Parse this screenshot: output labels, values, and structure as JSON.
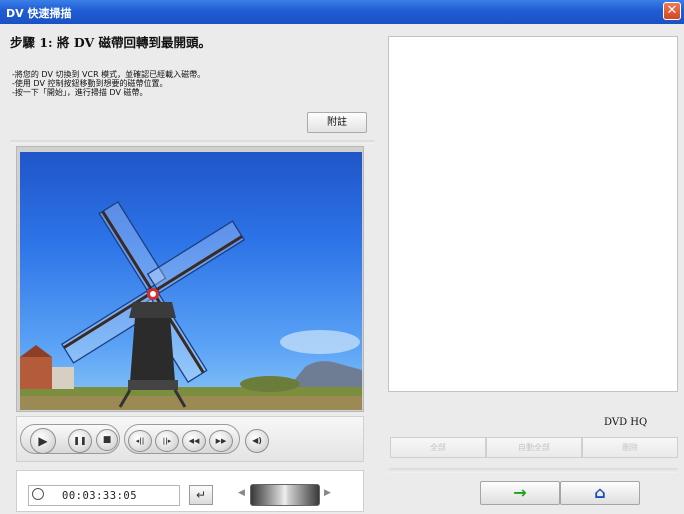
{
  "window": {
    "title": "DV 快速掃描",
    "close_glyph": "✕"
  },
  "step": {
    "heading": "步驟 1: 將 DV 磁帶回轉到最開頭。",
    "instructions": "-將您的 DV 切換到 VCR 模式，並確認已經載入磁帶。\n-使用 DV 控制按鈕移動到想要的磁帶位置。\n-按一下「開始」，進行掃描 DV 磁帶。",
    "notes_label": "附註"
  },
  "player": {
    "timecode": "00:03:33:05",
    "enter_glyph": "↵",
    "buttons": [
      {
        "name": "play-button",
        "glyph": "▶"
      },
      {
        "name": "pause-button",
        "glyph": "❚❚"
      },
      {
        "name": "stop-button",
        "glyph": "■"
      },
      {
        "name": "previous-frame-button",
        "glyph": "◂||"
      },
      {
        "name": "next-frame-button",
        "glyph": "||▸"
      },
      {
        "name": "rewind-button",
        "glyph": "◀◀"
      },
      {
        "name": "fast-forward-button",
        "glyph": "▶▶"
      },
      {
        "name": "volume-button",
        "glyph": "◀)"
      }
    ],
    "shuttle_left_glyph": "◀",
    "shuttle_right_glyph": "▶"
  },
  "right": {
    "quality": "DVD HQ",
    "buttons": [
      "全部",
      "自動全部",
      "刪除"
    ],
    "next_glyph": "→",
    "home_glyph": "⌂"
  },
  "colors": {
    "accent_green": "#1aa31a",
    "home_blue": "#1c4fb8",
    "titlebar": "#1f5cd3"
  }
}
